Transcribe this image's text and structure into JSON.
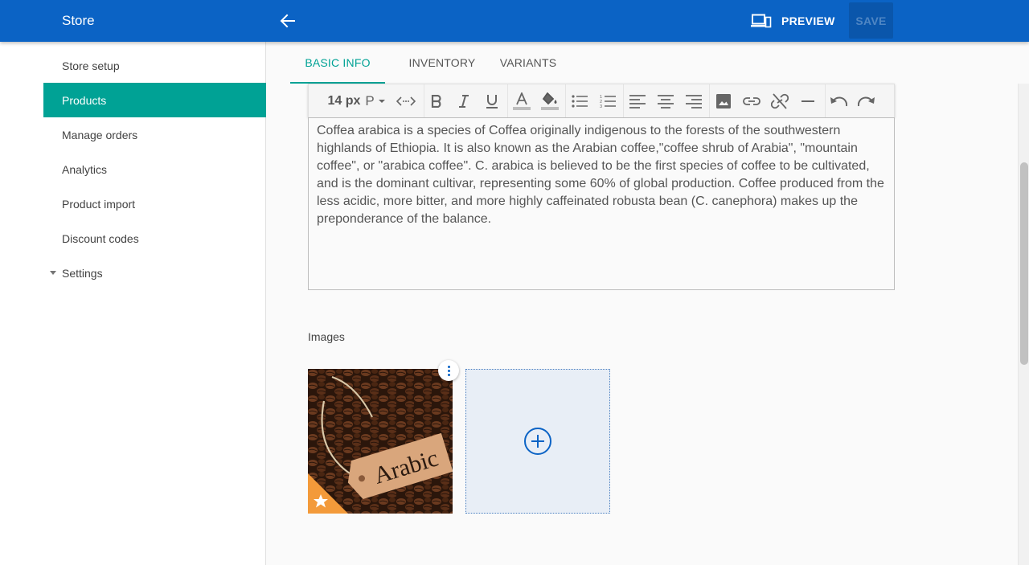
{
  "topbar": {
    "title": "Store",
    "back_icon": "arrow-left-icon",
    "preview_icon": "devices-icon",
    "preview_label": "PREVIEW",
    "save_label": "SAVE",
    "color": "#0b63c5"
  },
  "sidebar": {
    "items": [
      {
        "label": "Store setup",
        "active": false
      },
      {
        "label": "Products",
        "active": true
      },
      {
        "label": "Manage orders",
        "active": false
      },
      {
        "label": "Analytics",
        "active": false
      },
      {
        "label": "Product import",
        "active": false
      },
      {
        "label": "Discount codes",
        "active": false
      },
      {
        "label": "Settings",
        "active": false,
        "expandable": true
      }
    ],
    "active_color": "#00a295"
  },
  "tabs": [
    {
      "label": "BASIC INFO",
      "active": true
    },
    {
      "label": "INVENTORY",
      "active": false
    },
    {
      "label": "VARIANTS",
      "active": false
    }
  ],
  "toolbar": {
    "font_size": "14 px",
    "paragraph": "P",
    "icons": [
      "code-icon",
      "bold-icon",
      "italic-icon",
      "underline-icon",
      "text-color-icon",
      "fill-color-icon",
      "bulleted-list-icon",
      "numbered-list-icon",
      "align-left-icon",
      "align-center-icon",
      "align-right-icon",
      "image-icon",
      "link-icon",
      "unlink-icon",
      "horizontal-rule-icon",
      "undo-icon",
      "redo-icon"
    ]
  },
  "editor": {
    "text": "Coffea arabica is a species of Coffea originally indigenous to the forests of the southwestern highlands of Ethiopia. It is also known as the Arabian coffee,\"coffee shrub of Arabia\", \"mountain coffee\", or \"arabica coffee\". C. arabica is believed to be the first species of coffee to be cultivated, and is the dominant cultivar, representing some 60% of global production. Coffee produced from the less acidic, more bitter, and more highly caffeinated robusta bean (C. canephora) makes up the preponderance of the balance."
  },
  "images": {
    "label": "Images",
    "thumbnail_tag_text": "Arabic",
    "featured_icon": "star-icon",
    "menu_icon": "more-vert-icon",
    "add_icon": "add-circle-icon"
  }
}
